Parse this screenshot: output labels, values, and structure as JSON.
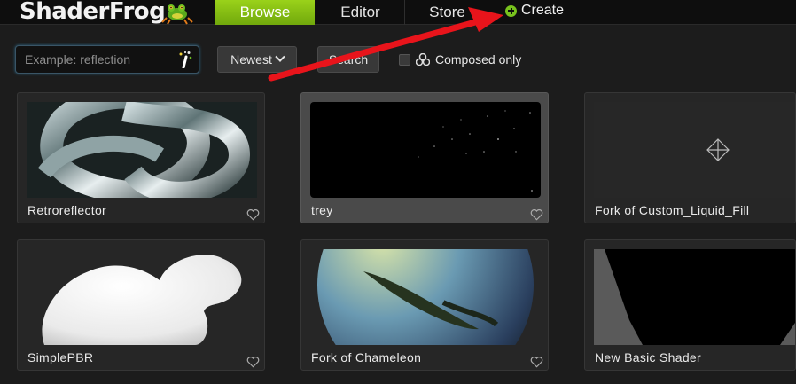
{
  "header": {
    "logo_text": "ShaderFrog",
    "tabs": [
      {
        "label": "Browse",
        "active": true
      },
      {
        "label": "Editor",
        "active": false
      },
      {
        "label": "Store",
        "active": false
      }
    ],
    "create_label": "Create",
    "accent_color": "#86c017"
  },
  "filters": {
    "search_placeholder": "Example: reflection",
    "search_value": "",
    "sort_label": "Newest",
    "search_button_label": "Search",
    "composed_only_label": "Composed only",
    "composed_only_checked": false
  },
  "shaders": [
    {
      "title": "Retroreflector",
      "thumbnail": "metallic-knot",
      "selected": false
    },
    {
      "title": "trey",
      "thumbnail": "starfield",
      "selected": true
    },
    {
      "title": "Fork of Custom_Liquid_Fill",
      "thumbnail": "empty-placeholder",
      "selected": false
    },
    {
      "title": "SimplePBR",
      "thumbnail": "white-bunny",
      "selected": false
    },
    {
      "title": "Fork of Chameleon",
      "thumbnail": "chameleon-sphere",
      "selected": false
    },
    {
      "title": "New Basic Shader",
      "thumbnail": "dark-trapezoid",
      "selected": false
    }
  ],
  "annotation": {
    "type": "red-arrow",
    "points_to": "Create"
  }
}
